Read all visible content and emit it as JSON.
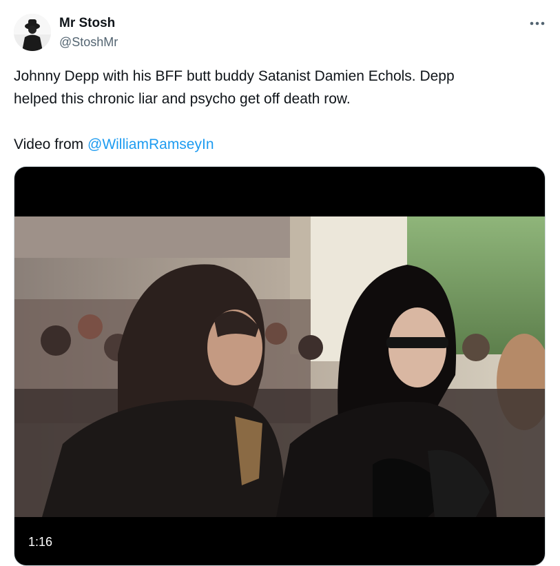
{
  "author": {
    "display_name": "Mr Stosh",
    "handle": "@StoshMr"
  },
  "tweet": {
    "line1": "Johnny Depp with his BFF butt buddy Satanist Damien Echols.  Depp",
    "line2": "helped this chronic liar and psycho get off death row.",
    "video_prefix": "Video from ",
    "mention": "@WilliamRamseyIn"
  },
  "media": {
    "type": "video",
    "duration": "1:16"
  },
  "icons": {
    "more": "more-horizontal-icon",
    "avatar": "avatar-silhouette"
  },
  "colors": {
    "text": "#0f1419",
    "secondary": "#536471",
    "link": "#1d9bf0"
  }
}
